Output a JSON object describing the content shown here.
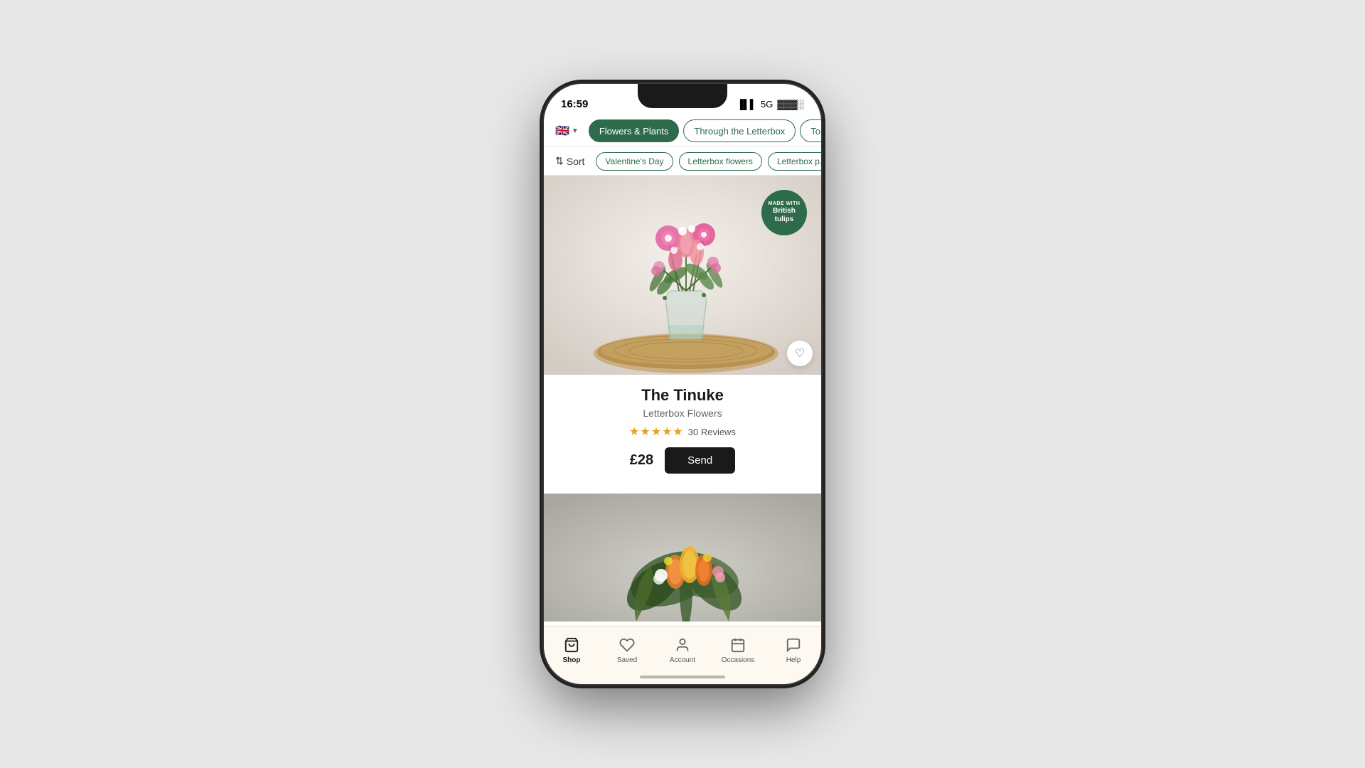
{
  "status_bar": {
    "time": "16:59",
    "signal": "▐▌▌",
    "network": "5G",
    "battery": "🔋"
  },
  "nav_tabs": {
    "flag": "🇬🇧",
    "tabs": [
      {
        "label": "Flowers & Plants",
        "active": true
      },
      {
        "label": "Through the Letterbox",
        "active": false
      },
      {
        "label": "To the...",
        "active": false
      }
    ]
  },
  "filter_bar": {
    "sort_label": "Sort",
    "chips": [
      {
        "label": "Valentine's Day",
        "active": false
      },
      {
        "label": "Letterbox flowers",
        "active": false
      },
      {
        "label": "Letterbox p...",
        "active": false
      }
    ]
  },
  "product1": {
    "name": "The Tinuke",
    "subtitle": "Letterbox Flowers",
    "stars": 5,
    "star_char": "★",
    "reviews": "30 Reviews",
    "price": "£28",
    "send_label": "Send",
    "badge_line1": "MADE WITH",
    "badge_line2": "British",
    "badge_line3": "tulips",
    "badge_line4": "MADE WITH",
    "wishlist_icon": "♡"
  },
  "bottom_nav": {
    "items": [
      {
        "label": "Shop",
        "icon": "🛍",
        "active": true
      },
      {
        "label": "Saved",
        "icon": "♡",
        "active": false
      },
      {
        "label": "Account",
        "icon": "👤",
        "active": false
      },
      {
        "label": "Occasions",
        "icon": "📅",
        "active": false
      },
      {
        "label": "Help",
        "icon": "💬",
        "active": false
      }
    ]
  }
}
